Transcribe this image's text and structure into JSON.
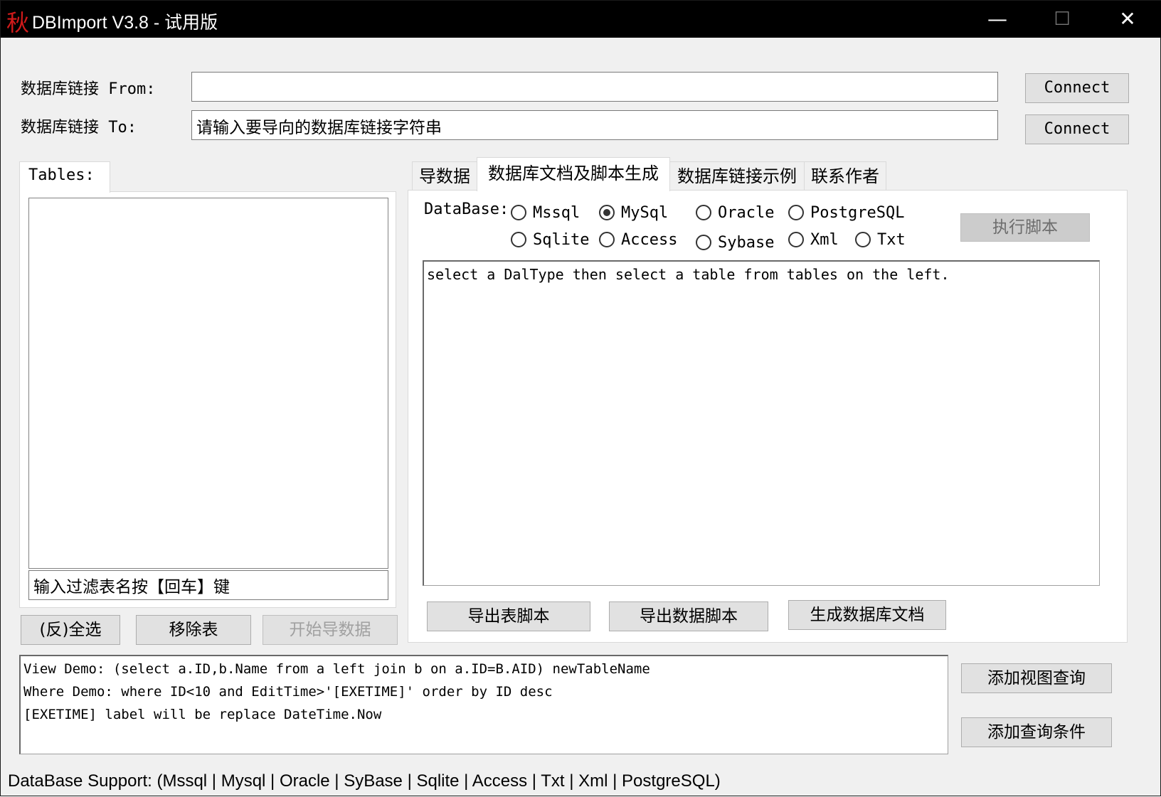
{
  "window": {
    "icon_glyph": "秋",
    "title": "DBImport V3.8 - 试用版",
    "minimize_glyph": "—",
    "maximize_glyph": "☐",
    "close_glyph": "✕"
  },
  "connection": {
    "from_label": "数据库链接 From:",
    "from_value": "",
    "to_label": "数据库链接 To:",
    "to_placeholder": "请输入要导向的数据库链接字符串",
    "connect_from_label": "Connect",
    "connect_to_label": "Connect"
  },
  "tables": {
    "group_label": "Tables:",
    "items": [],
    "filter_placeholder": "输入过滤表名按【回车】键",
    "select_all_label": "(反)全选",
    "remove_label": "移除表",
    "start_import_label": "开始导数据"
  },
  "tabs": [
    {
      "label": "导数据"
    },
    {
      "label": "数据库文档及脚本生成",
      "active": true
    },
    {
      "label": "数据库链接示例"
    },
    {
      "label": "联系作者"
    }
  ],
  "script_panel": {
    "database_label": "DataBase:",
    "databases": [
      {
        "label": "Mssql",
        "checked": false
      },
      {
        "label": "MySql",
        "checked": true
      },
      {
        "label": "Oracle",
        "checked": false
      },
      {
        "label": "PostgreSQL",
        "checked": false
      },
      {
        "label": "Sqlite",
        "checked": false
      },
      {
        "label": "Access",
        "checked": false
      },
      {
        "label": "Sybase",
        "checked": false
      },
      {
        "label": "Xml",
        "checked": false
      },
      {
        "label": "Txt",
        "checked": false
      }
    ],
    "execute_label": "执行脚本",
    "output_text": "select a DalType then select a table from tables on the left.",
    "export_table_script_label": "导出表脚本",
    "export_data_script_label": "导出数据脚本",
    "generate_doc_label": "生成数据库文档"
  },
  "query": {
    "lines": [
      "View  Demo: (select a.ID,b.Name from a left join b on a.ID=B.AID) newTableName",
      "Where Demo: where ID<10 and EditTime>'[EXETIME]' order by ID desc",
      "[EXETIME] label will be replace DateTime.Now"
    ],
    "add_view_label": "添加视图查询",
    "add_condition_label": "添加查询条件"
  },
  "status": {
    "text": "DataBase Support:    (Mssql | Mysql | Oracle | SyBase | Sqlite | Access | Txt | Xml | PostgreSQL)"
  }
}
